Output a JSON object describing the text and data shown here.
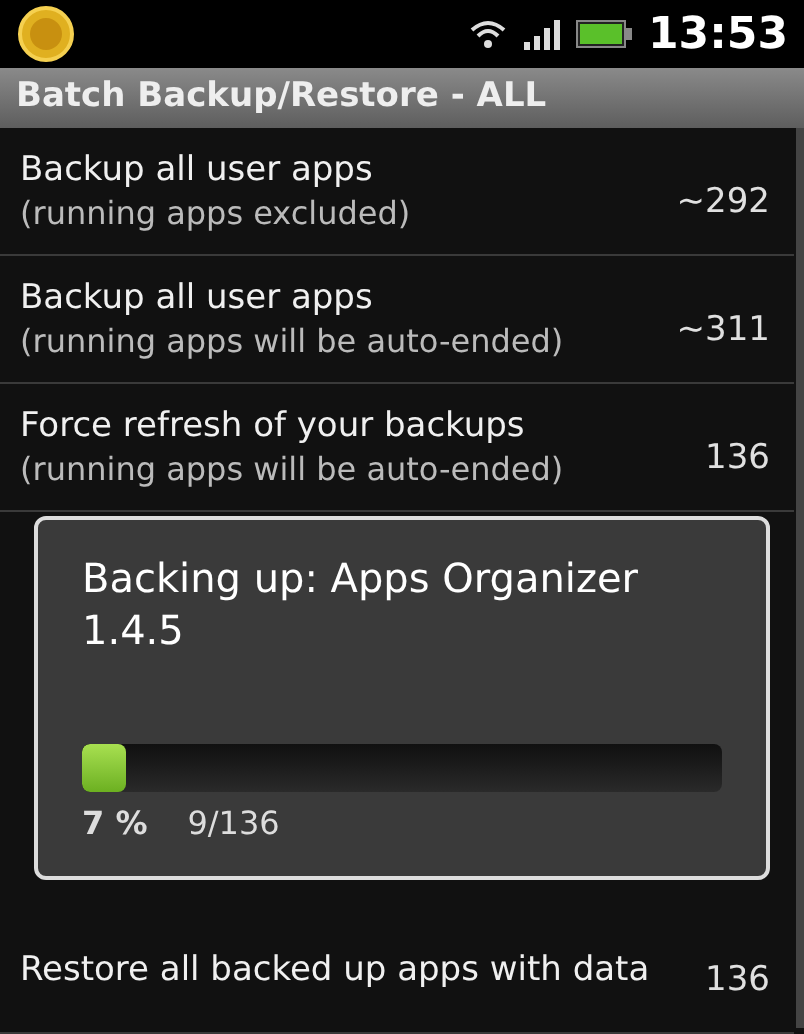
{
  "status_bar": {
    "time": "13:53"
  },
  "title_bar": {
    "title": "Batch Backup/Restore - ALL"
  },
  "rows": [
    {
      "title": "Backup all user apps",
      "subtitle": "(running apps excluded)",
      "count": "~292"
    },
    {
      "title": "Backup all user apps",
      "subtitle": "(running apps will be auto-ended)",
      "count": "~311"
    },
    {
      "title": "Force refresh of your backups",
      "subtitle": "(running apps will be auto-ended)",
      "count": "136"
    },
    {
      "title": "Restore all backed up apps with data",
      "count": "136"
    }
  ],
  "dialog": {
    "title": "Backing up: Apps Organizer 1.4.5",
    "progress": {
      "level": 0.07,
      "percent": "7 %",
      "count": "9/136"
    }
  }
}
